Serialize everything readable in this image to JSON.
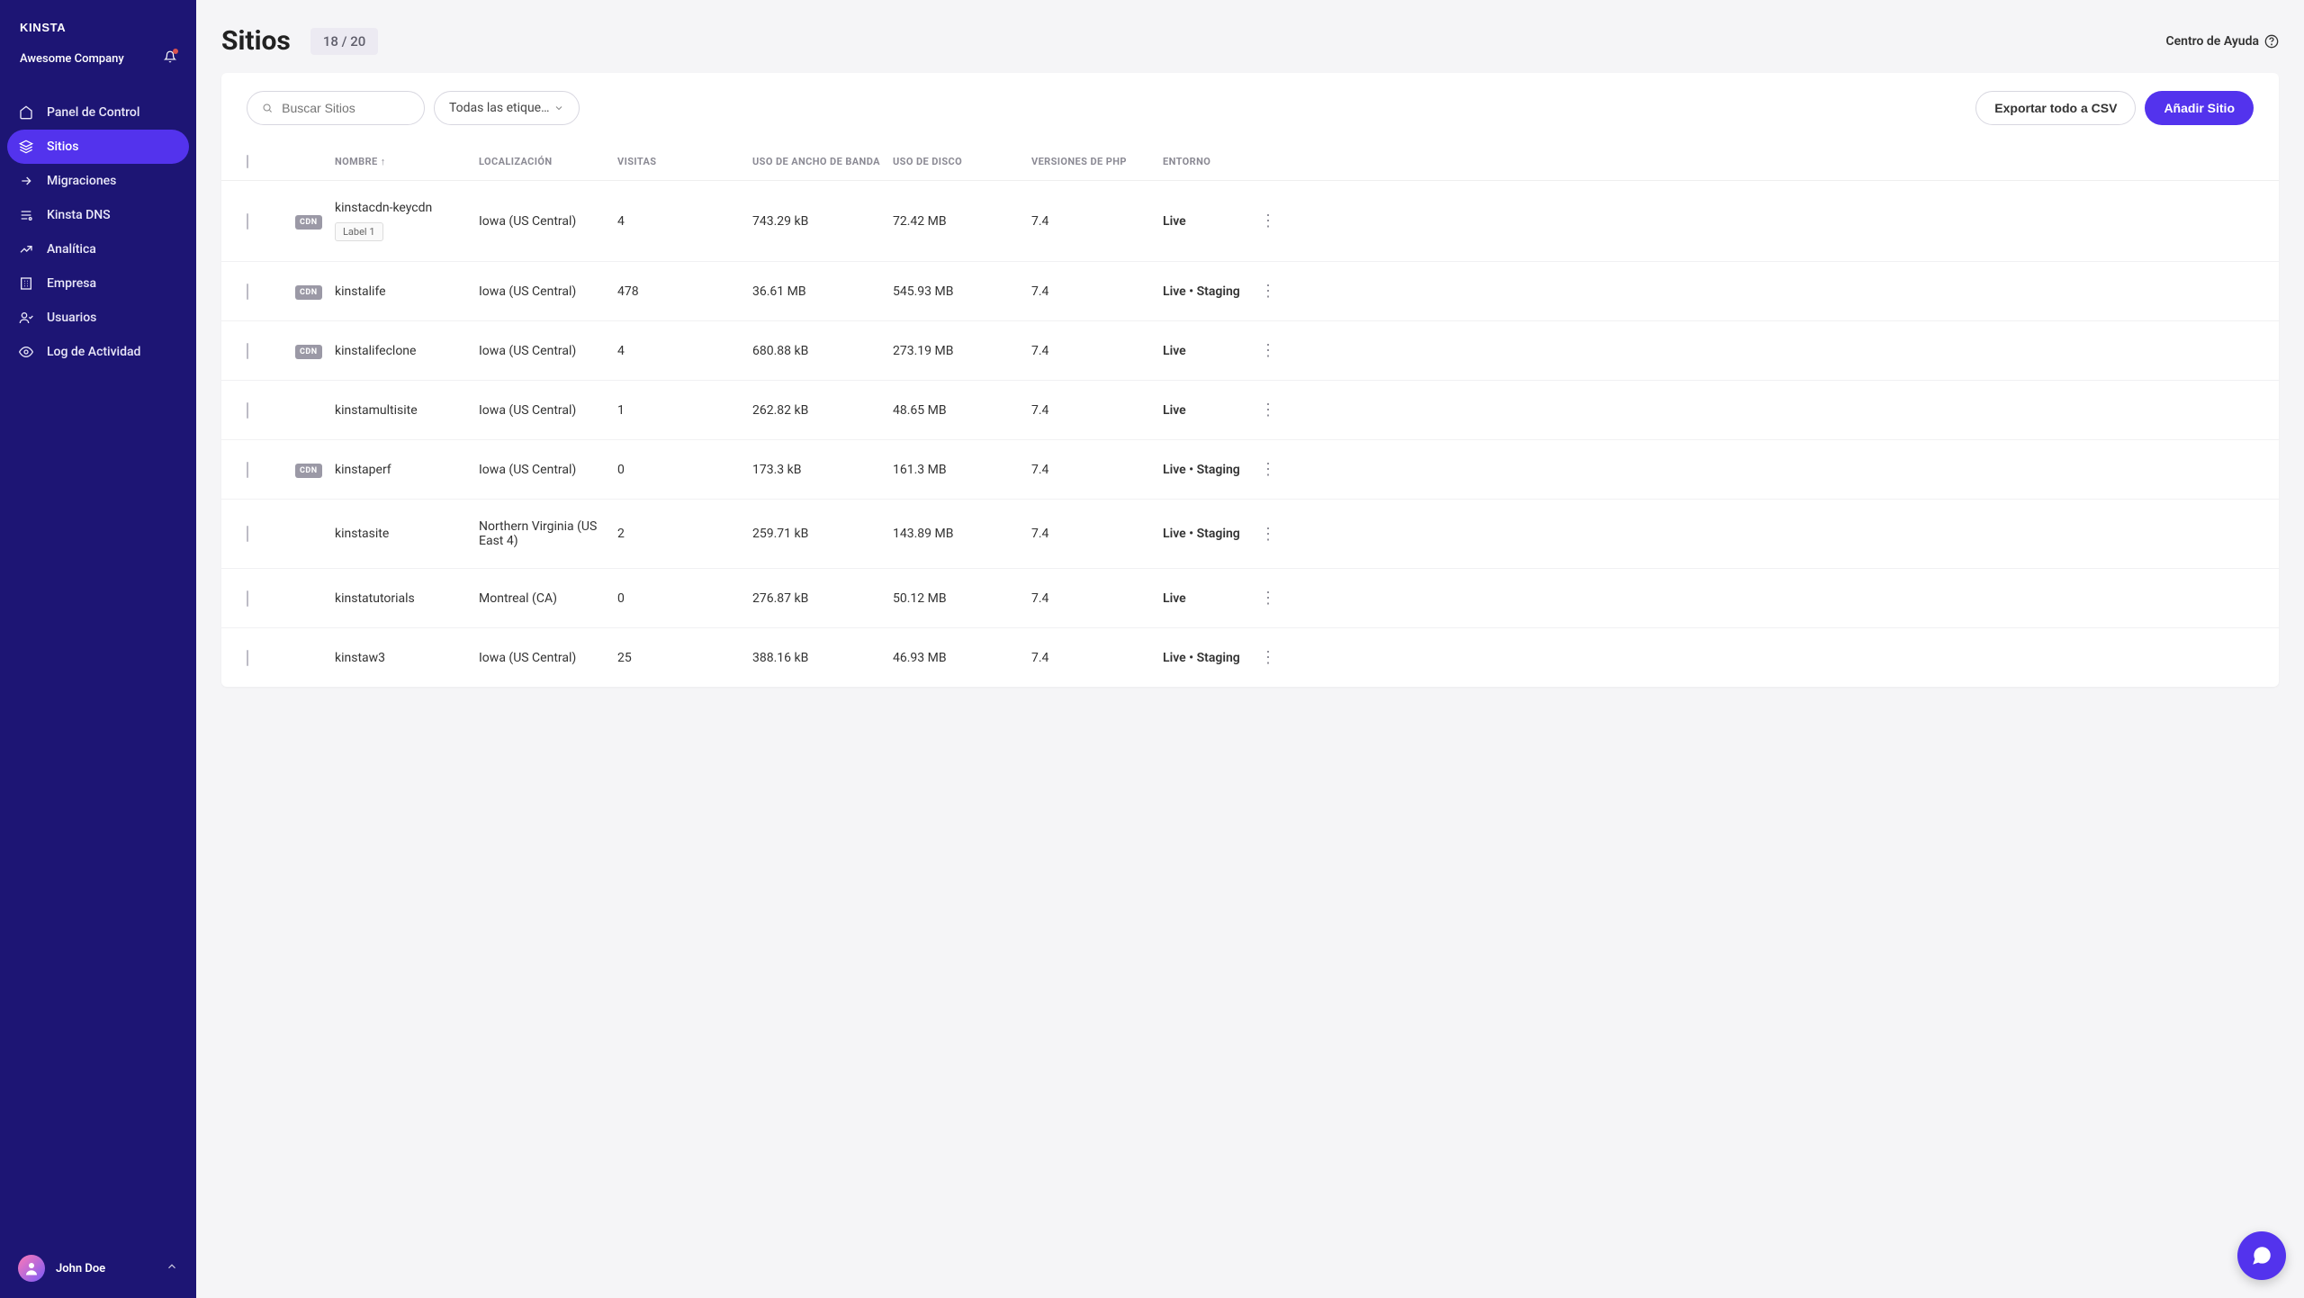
{
  "brand": "KINSTA",
  "company": "Awesome Company",
  "user": {
    "name": "John Doe"
  },
  "nav": [
    {
      "key": "dashboard",
      "label": "Panel de Control"
    },
    {
      "key": "sites",
      "label": "Sitios"
    },
    {
      "key": "migrations",
      "label": "Migraciones"
    },
    {
      "key": "dns",
      "label": "Kinsta DNS"
    },
    {
      "key": "analytics",
      "label": "Analítica"
    },
    {
      "key": "company",
      "label": "Empresa"
    },
    {
      "key": "users",
      "label": "Usuarios"
    },
    {
      "key": "activity",
      "label": "Log de Actividad"
    }
  ],
  "page": {
    "title": "Sitios",
    "count": "18 / 20",
    "help": "Centro de Ayuda"
  },
  "toolbar": {
    "search_placeholder": "Buscar Sitios",
    "labels_filter": "Todas las etique…",
    "export_csv": "Exportar todo a CSV",
    "add_site": "Añadir Sitio"
  },
  "columns": {
    "name": "NOMBRE",
    "location": "LOCALIZACIÓN",
    "visits": "VISITAS",
    "bandwidth": "USO DE ANCHO DE BANDA",
    "disk": "USO DE DISCO",
    "php": "VERSIONES DE PHP",
    "env": "ENTORNO"
  },
  "cdn_badge": "CDN",
  "rows": [
    {
      "cdn": true,
      "name": "kinstacdn-keycdn",
      "labels": [
        "Label 1"
      ],
      "location": "Iowa (US Central)",
      "visits": "4",
      "bandwidth": "743.29 kB",
      "disk": "72.42 MB",
      "php": "7.4",
      "env": "Live"
    },
    {
      "cdn": true,
      "name": "kinstalife",
      "labels": [],
      "location": "Iowa (US Central)",
      "visits": "478",
      "bandwidth": "36.61 MB",
      "disk": "545.93 MB",
      "php": "7.4",
      "env": "Live • Staging"
    },
    {
      "cdn": true,
      "name": "kinstalifeclone",
      "labels": [],
      "location": "Iowa (US Central)",
      "visits": "4",
      "bandwidth": "680.88 kB",
      "disk": "273.19 MB",
      "php": "7.4",
      "env": "Live"
    },
    {
      "cdn": false,
      "name": "kinstamultisite",
      "labels": [],
      "location": "Iowa (US Central)",
      "visits": "1",
      "bandwidth": "262.82 kB",
      "disk": "48.65 MB",
      "php": "7.4",
      "env": "Live"
    },
    {
      "cdn": true,
      "name": "kinstaperf",
      "labels": [],
      "location": "Iowa (US Central)",
      "visits": "0",
      "bandwidth": "173.3 kB",
      "disk": "161.3 MB",
      "php": "7.4",
      "env": "Live • Staging"
    },
    {
      "cdn": false,
      "name": "kinstasite",
      "labels": [],
      "location": "Northern Virginia (US East 4)",
      "visits": "2",
      "bandwidth": "259.71 kB",
      "disk": "143.89 MB",
      "php": "7.4",
      "env": "Live • Staging"
    },
    {
      "cdn": false,
      "name": "kinstatutorials",
      "labels": [],
      "location": "Montreal (CA)",
      "visits": "0",
      "bandwidth": "276.87 kB",
      "disk": "50.12 MB",
      "php": "7.4",
      "env": "Live"
    },
    {
      "cdn": false,
      "name": "kinstaw3",
      "labels": [],
      "location": "Iowa (US Central)",
      "visits": "25",
      "bandwidth": "388.16 kB",
      "disk": "46.93 MB",
      "php": "7.4",
      "env": "Live • Staging"
    }
  ]
}
